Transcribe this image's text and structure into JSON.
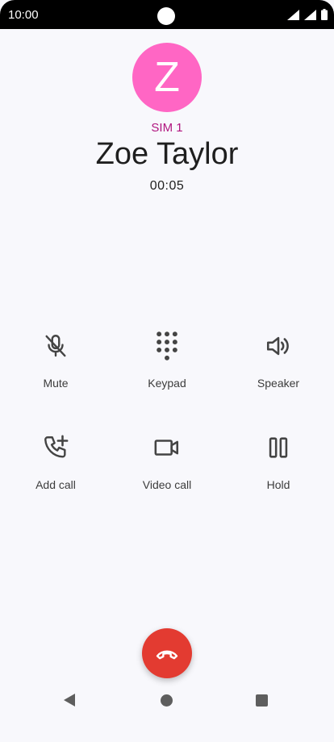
{
  "status_bar": {
    "time": "10:00",
    "icons": [
      "wifi-icon",
      "signal-icon",
      "battery-icon"
    ]
  },
  "caller": {
    "avatar_letter": "Z",
    "avatar_color": "#ff66c4",
    "sim": "SIM 1",
    "name": "Zoe Taylor",
    "duration": "00:05"
  },
  "controls": [
    {
      "icon": "mic-off-icon",
      "label": "Mute"
    },
    {
      "icon": "dialpad-icon",
      "label": "Keypad"
    },
    {
      "icon": "speaker-icon",
      "label": "Speaker"
    },
    {
      "icon": "add-call-icon",
      "label": "Add call"
    },
    {
      "icon": "video-call-icon",
      "label": "Video call"
    },
    {
      "icon": "pause-icon",
      "label": "Hold"
    }
  ],
  "end_call": {
    "icon": "call-end-icon",
    "color": "#e33b31"
  },
  "nav_bar": {
    "icons": [
      "back-icon",
      "home-icon",
      "recents-icon"
    ]
  }
}
